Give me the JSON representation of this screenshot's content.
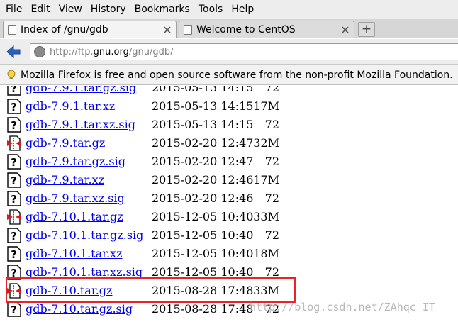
{
  "menu": {
    "file": "File",
    "edit": "Edit",
    "view": "View",
    "history": "History",
    "bookmarks": "Bookmarks",
    "tools": "Tools",
    "help": "Help"
  },
  "tabs": [
    {
      "label": "Index of /gnu/gdb",
      "active": true
    },
    {
      "label": "Welcome to CentOS",
      "active": false
    }
  ],
  "nav": {
    "url_prefix": "http://ftp.",
    "url_host": "gnu.org",
    "url_path": "/gnu/gdb/"
  },
  "notice": {
    "text": "Mozilla Firefox is free and open source software from the non-profit Mozilla Foundation."
  },
  "files": [
    {
      "name": "gdb-7.9.1.tar.gz.sig",
      "date": "2015-05-13 14:15",
      "size": "72",
      "icon": "text"
    },
    {
      "name": "gdb-7.9.1.tar.xz",
      "date": "2015-05-13 14:15",
      "size": "17M",
      "icon": "text"
    },
    {
      "name": "gdb-7.9.1.tar.xz.sig",
      "date": "2015-05-13 14:15",
      "size": "72",
      "icon": "text"
    },
    {
      "name": "gdb-7.9.tar.gz",
      "date": "2015-02-20 12:47",
      "size": "32M",
      "icon": "archive"
    },
    {
      "name": "gdb-7.9.tar.gz.sig",
      "date": "2015-02-20 12:47",
      "size": "72",
      "icon": "text"
    },
    {
      "name": "gdb-7.9.tar.xz",
      "date": "2015-02-20 12:46",
      "size": "17M",
      "icon": "text"
    },
    {
      "name": "gdb-7.9.tar.xz.sig",
      "date": "2015-02-20 12:46",
      "size": "72",
      "icon": "text"
    },
    {
      "name": "gdb-7.10.1.tar.gz",
      "date": "2015-12-05 10:40",
      "size": "33M",
      "icon": "archive"
    },
    {
      "name": "gdb-7.10.1.tar.gz.sig",
      "date": "2015-12-05 10:40",
      "size": "72",
      "icon": "text"
    },
    {
      "name": "gdb-7.10.1.tar.xz",
      "date": "2015-12-05 10:40",
      "size": "18M",
      "icon": "text"
    },
    {
      "name": "gdb-7.10.1.tar.xz.sig",
      "date": "2015-12-05 10:40",
      "size": "72",
      "icon": "text"
    },
    {
      "name": "gdb-7.10.tar.gz",
      "date": "2015-08-28 17:48",
      "size": "33M",
      "icon": "archive",
      "highlighted": true
    },
    {
      "name": "gdb-7.10.tar.gz.sig",
      "date": "2015-08-28 17:48",
      "size": "72",
      "icon": "text"
    }
  ],
  "watermark": "http://blog.csdn.net/ZAhqc_IT",
  "colors": {
    "link": "#0000ee",
    "highlight_box": "#e8242b",
    "back_arrow": "#2a62b8"
  }
}
